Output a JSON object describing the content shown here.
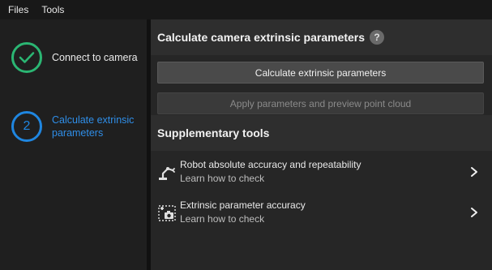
{
  "menubar": {
    "items": [
      "Files",
      "Tools"
    ]
  },
  "sidebar": {
    "steps": [
      {
        "label": "Connect to camera",
        "status": "done"
      },
      {
        "number": "2",
        "label": "Calculate extrinsic parameters",
        "status": "active"
      }
    ]
  },
  "main": {
    "header_title": "Calculate camera extrinsic parameters",
    "help_symbol": "?",
    "calculate_button": "Calculate extrinsic parameters",
    "apply_button": "Apply parameters and preview point cloud",
    "supplementary_title": "Supplementary tools",
    "tools": [
      {
        "title": "Robot absolute accuracy and repeatability",
        "subtitle": "Learn how to check",
        "icon": "robot-arm-icon"
      },
      {
        "title": "Extrinsic parameter accuracy",
        "subtitle": "Learn how to check",
        "icon": "camera-target-icon"
      }
    ]
  },
  "colors": {
    "done": "#2bb673",
    "active": "#1f86e0"
  }
}
